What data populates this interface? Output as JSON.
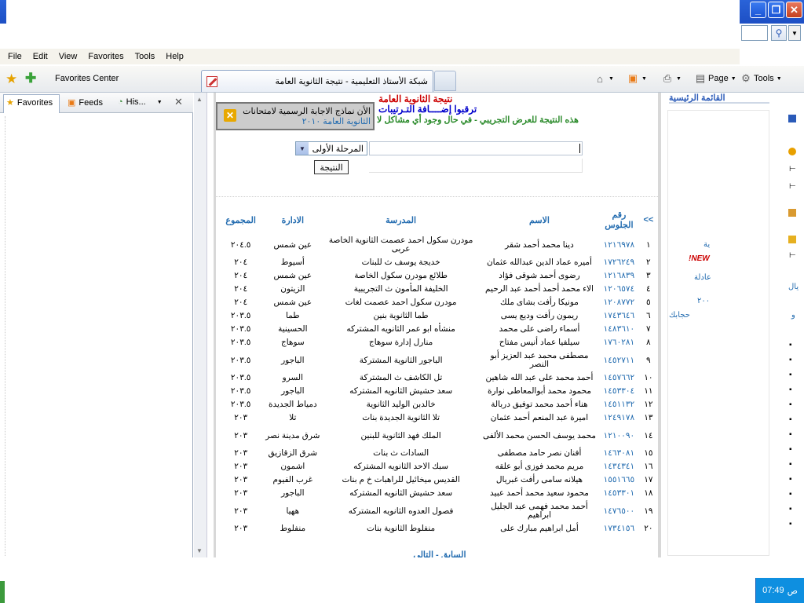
{
  "window": {
    "minimize": "_",
    "maximize": "❐",
    "close": "✕"
  },
  "menu": [
    "File",
    "Edit",
    "View",
    "Favorites",
    "Tools",
    "Help"
  ],
  "commandbar": {
    "favorites_center": "Favorites Center",
    "tab_title": "شبكة الأستاذ التعليمية - نتيجة الثانوية العامة",
    "page_label": "Page",
    "tools_label": "Tools"
  },
  "favpane": {
    "tabs": [
      "Favorites",
      "Feeds",
      "His..."
    ],
    "close": "✕"
  },
  "page": {
    "notice_line1": "الأن نماذج الاجابة الرسمية لامتحانات",
    "notice_line2": "الثانوية العامة ٢٠١٠",
    "header1": "نتيجة الثانوية العامة",
    "header2": "ترقبوا إضــــافة التـرتيبات",
    "header3": "هذه النتيجة للعرض التجريبي - في حال وجود أي مشاكل لا",
    "stage_value": "المرحلة الأولى",
    "result_button": "النتيجة",
    "pager": "السابق - التالي"
  },
  "table": {
    "headers": {
      "nav": ">>",
      "seat": "رقم الجلوس",
      "name": "الاسم",
      "school": "المدرسة",
      "admin": "الادارة",
      "total": "المجموع"
    },
    "rows": [
      {
        "n": "١",
        "seat": "١٢١٦٩٧٨",
        "name": "دينا محمد أحمد شقر",
        "school": "مودرن سكول احمد عصمت الثانوية الخاصة عربى",
        "admin": "عين شمس",
        "total": "٢٠٤.٥"
      },
      {
        "n": "٢",
        "seat": "١٧٢٦٢٤٩",
        "name": "أميره عماد الدين عبدالله عثمان",
        "school": "خديجة يوسف ث للبنات",
        "admin": "أسيوط",
        "total": "٢٠٤"
      },
      {
        "n": "٣",
        "seat": "١٢١٦٨٣٩",
        "name": "رضوى أحمد شوقى فؤاد",
        "school": "طلائع مودرن سكول الخاصة",
        "admin": "عين شمس",
        "total": "٢٠٤"
      },
      {
        "n": "٤",
        "seat": "١٢٠٦٥٧٤",
        "name": "الاء محمد أحمد أحمد عبد الرحيم",
        "school": "الخليفة المأمون ث التجريبية",
        "admin": "الزيتون",
        "total": "٢٠٤"
      },
      {
        "n": "٥",
        "seat": "١٢٠٨٧٧٢",
        "name": "مونيكا رأفت بشاى ملك",
        "school": "مودرن سكول احمد عصمت لغات",
        "admin": "عين شمس",
        "total": "٢٠٤"
      },
      {
        "n": "٦",
        "seat": "١٧٤٣٦٤٦",
        "name": "ريمون رأفت وديع يسى",
        "school": "طما الثانوية بنين",
        "admin": "طما",
        "total": "٢٠٣.٥"
      },
      {
        "n": "٧",
        "seat": "١٤٨٣٦١٠",
        "name": "أسماء راضى على محمد",
        "school": "منشأه ابو عمر الثانويه المشتركه",
        "admin": "الحسينية",
        "total": "٢٠٣.٥"
      },
      {
        "n": "٨",
        "seat": "١٧٦٠٢٨١",
        "name": "سيلفيا عماد أنيس مفتاح",
        "school": "منارل إدارة سوهاج",
        "admin": "سوهاج",
        "total": "٢٠٣.٥"
      },
      {
        "n": "٩",
        "seat": "١٤٥٢٧١١",
        "name": "مصطفى محمد عبد العزيز أبو النصر",
        "school": "الباجور الثانوية المشتركة",
        "admin": "الباجور",
        "total": "٢٠٣.٥"
      },
      {
        "n": "١٠",
        "seat": "١٤٥٧٦٦٢",
        "name": "أحمد محمد على عبد الله شاهين",
        "school": "تل الكاشف ث المشتركة",
        "admin": "السرو",
        "total": "٢٠٣.٥"
      },
      {
        "n": "١١",
        "seat": "١٤٥٣٣٠٤",
        "name": "محمود محمد أبوالمعاطى نوارة",
        "school": "سعد حشيش الثانويه المشتركه",
        "admin": "الباجور",
        "total": "٢٠٣.٥"
      },
      {
        "n": "١٢",
        "seat": "١٤٥١١٣٢",
        "name": "هناء أحمد محمد توفيق دربالة",
        "school": "خالدبن الوليد الثانوية",
        "admin": "دمياط الجديدة",
        "total": "٢٠٣.٥"
      },
      {
        "n": "١٣",
        "seat": "١٢٤٩١٧٨",
        "name": "اميرة عبد المنعم أحمد عثمان",
        "school": "تلا الثانوية الجديدة بنات",
        "admin": "تلا",
        "total": "٢٠٣"
      },
      {
        "n": "١٤",
        "seat": "١٢١٠٠٩٠",
        "name": "محمد يوسف الحسن محمد الألفى",
        "school": "الملك فهد الثانوية للبنين",
        "admin": "شرق مدينة نصر",
        "total": "٢٠٣"
      },
      {
        "n": "١٥",
        "seat": "١٤٦٣٠٨١",
        "name": "أفنان نصر حامد مصطفى",
        "school": "السادات ث بنات",
        "admin": "شرق الزقازيق",
        "total": "٢٠٣"
      },
      {
        "n": "١٦",
        "seat": "١٤٣٤٣٤١",
        "name": "مريم محمد فوزى أبو علقه",
        "school": "سبك الاحد الثانويه المشتركه",
        "admin": "اشمون",
        "total": "٢٠٣"
      },
      {
        "n": "١٧",
        "seat": "١٥٥١٦٦٥",
        "name": "هيلانه سامى رأفت غبريال",
        "school": "القديس ميخائيل للراهبات خ م بنات",
        "admin": "غرب الفيوم",
        "total": "٢٠٣"
      },
      {
        "n": "١٨",
        "seat": "١٤٥٣٣٠١",
        "name": "محمود سعيد محمد أحمد عبيد",
        "school": "سعد حشيش الثانويه المشتركه",
        "admin": "الباجور",
        "total": "٢٠٣"
      },
      {
        "n": "١٩",
        "seat": "١٤٧٦٥٠٠",
        "name": "أحمد محمد فهمى عبد الجليل ابراهيم",
        "school": "فصول العدوه الثانويه المشتركه",
        "admin": "ههيا",
        "total": "٢٠٣"
      },
      {
        "n": "٢٠",
        "seat": "١٧٣٤١٥٦",
        "name": "أمل ابراهيم مبارك على",
        "school": "منفلوط الثانوية بنات",
        "admin": "منفلوط",
        "total": "٢٠٣"
      }
    ]
  },
  "sidebar": {
    "title": "القائمة الرئيسية",
    "frags": [
      "ية",
      "NEW!",
      "عادلة",
      "يال",
      "٢٠٠",
      "حجابك",
      "و"
    ]
  },
  "taskbar": {
    "time": "07:49",
    "ampm": "ص"
  },
  "colors": {
    "link_blue": "#236cb0",
    "red_header": "#cc0000",
    "green_header": "#2a8a2a"
  }
}
